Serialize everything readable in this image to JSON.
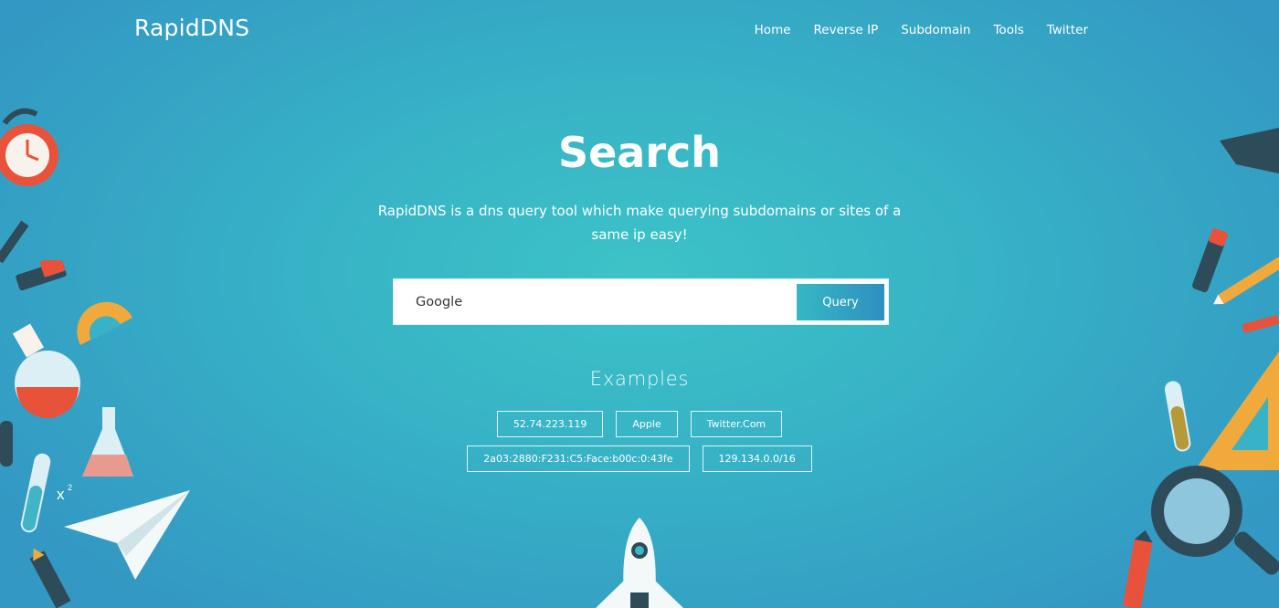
{
  "brand": "RapidDNS",
  "nav": [
    "Home",
    "Reverse IP",
    "Subdomain",
    "Tools",
    "Twitter"
  ],
  "hero": {
    "title": "Search",
    "description": "RapidDNS is a dns query tool which make querying subdomains or sites of a same ip easy!"
  },
  "search": {
    "value": "Google",
    "button_label": "Query"
  },
  "examples": {
    "title": "Examples",
    "row1": [
      "52.74.223.119",
      "Apple",
      "Twitter.Com"
    ],
    "row2": [
      "2a03:2880:F231:C5:Face:b00c:0:43fe",
      "129.134.0.0/16"
    ]
  }
}
